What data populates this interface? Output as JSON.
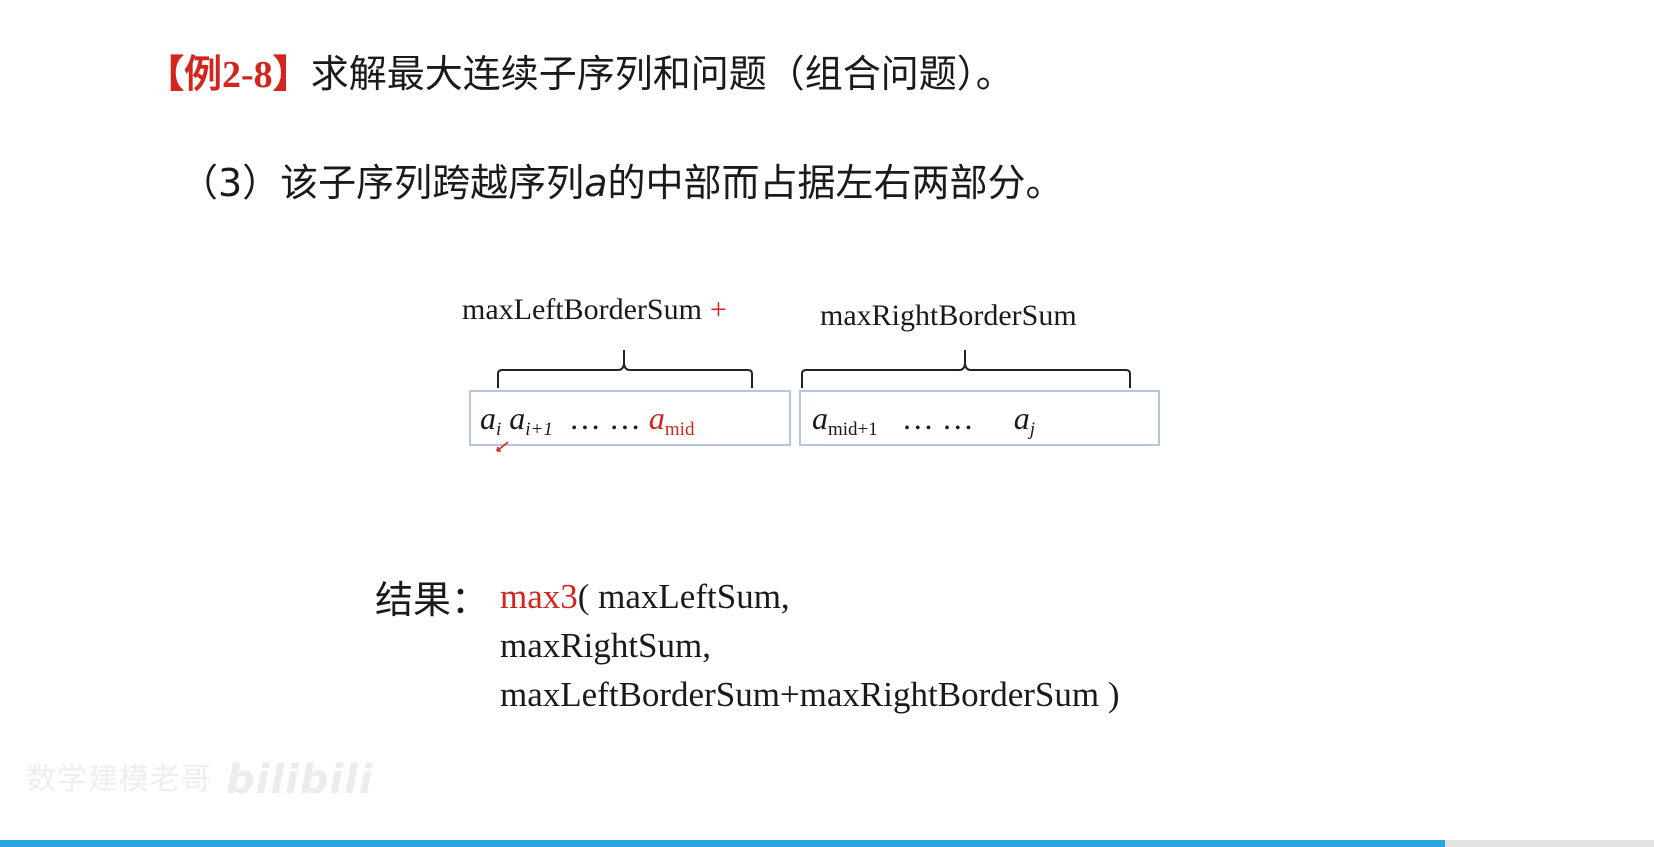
{
  "title": {
    "bracket_open": "【",
    "example_word": "例",
    "example_number": "2-8",
    "bracket_close": "】",
    "text": "求解最大连续子序列和问题（组合问题）。"
  },
  "subtitle": {
    "prefix": "（3）该子序列跨越序列",
    "var": "a",
    "suffix": "的中部而占据左右两部分。"
  },
  "diagram": {
    "left_label": "maxLeftBorderSum",
    "plus": "+",
    "right_label": "maxRightBorderSum",
    "left_cells": {
      "a1": "a",
      "s1": "i",
      "a2": "a",
      "s2": "i+1",
      "dots": "… …",
      "a3": "a",
      "s3": "mid"
    },
    "right_cells": {
      "a1": "a",
      "s1": "mid+1",
      "dots": "… …",
      "a2": "a",
      "s2": "j"
    }
  },
  "result": {
    "label": "结果：",
    "func": "max3",
    "line1": "( maxLeftSum,",
    "line2": "maxRightSum,",
    "line3": "maxLeftBorderSum+maxRightBorderSum )"
  },
  "watermark": {
    "text": "数学建模老哥",
    "logo": "bilibili"
  },
  "colors": {
    "accent_red": "#d0261e",
    "box_border": "#b6c6dc",
    "progress_bar": "#2aa6df"
  }
}
